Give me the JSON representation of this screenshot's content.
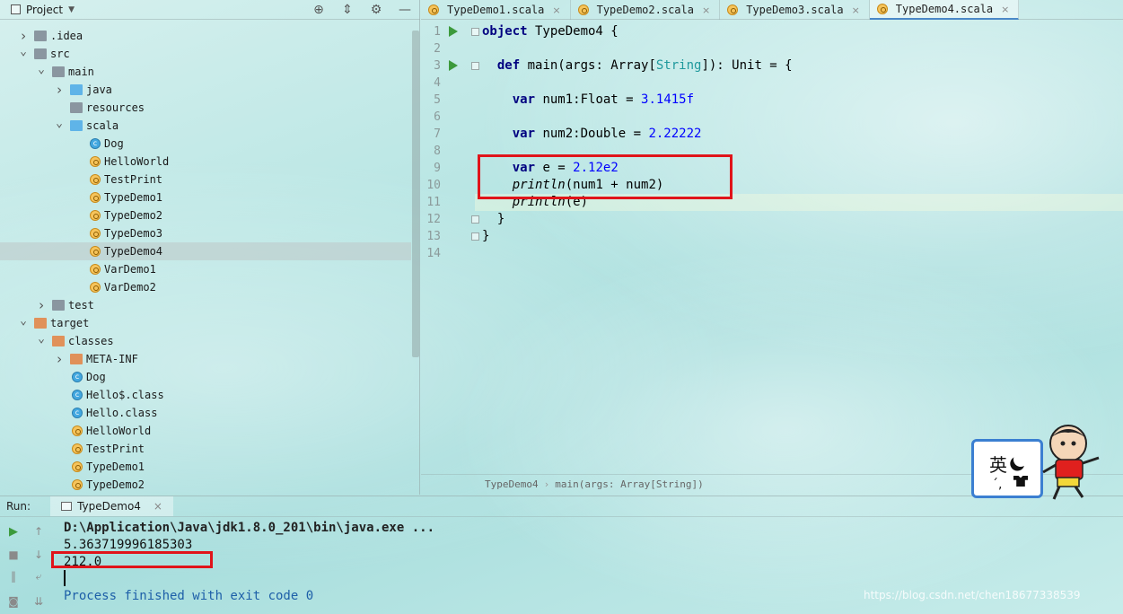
{
  "project_panel": {
    "title": "Project",
    "tree": [
      {
        "label": ".idea",
        "depth": 1,
        "expanded": false,
        "icon": "folder-gray"
      },
      {
        "label": "src",
        "depth": 1,
        "expanded": true,
        "icon": "folder-gray"
      },
      {
        "label": "main",
        "depth": 2,
        "expanded": true,
        "icon": "folder-gray"
      },
      {
        "label": "java",
        "depth": 3,
        "expanded": false,
        "icon": "folder-blue"
      },
      {
        "label": "resources",
        "depth": 3,
        "expanded": null,
        "icon": "folder-res"
      },
      {
        "label": "scala",
        "depth": 3,
        "expanded": true,
        "icon": "folder-blue"
      },
      {
        "label": "Dog",
        "depth": 4,
        "expanded": null,
        "icon": "class"
      },
      {
        "label": "HelloWorld",
        "depth": 4,
        "expanded": null,
        "icon": "object"
      },
      {
        "label": "TestPrint",
        "depth": 4,
        "expanded": null,
        "icon": "object"
      },
      {
        "label": "TypeDemo1",
        "depth": 4,
        "expanded": null,
        "icon": "object"
      },
      {
        "label": "TypeDemo2",
        "depth": 4,
        "expanded": null,
        "icon": "object"
      },
      {
        "label": "TypeDemo3",
        "depth": 4,
        "expanded": null,
        "icon": "object"
      },
      {
        "label": "TypeDemo4",
        "depth": 4,
        "expanded": null,
        "icon": "object",
        "selected": true
      },
      {
        "label": "VarDemo1",
        "depth": 4,
        "expanded": null,
        "icon": "object"
      },
      {
        "label": "VarDemo2",
        "depth": 4,
        "expanded": null,
        "icon": "object"
      },
      {
        "label": "test",
        "depth": 2,
        "expanded": false,
        "icon": "folder-gray"
      },
      {
        "label": "target",
        "depth": 1,
        "expanded": true,
        "icon": "folder-orange"
      },
      {
        "label": "classes",
        "depth": 2,
        "expanded": true,
        "icon": "folder-orange"
      },
      {
        "label": "META-INF",
        "depth": 3,
        "expanded": false,
        "icon": "folder-orange"
      },
      {
        "label": "Dog",
        "depth": 3,
        "expanded": null,
        "icon": "class"
      },
      {
        "label": "Hello$.class",
        "depth": 3,
        "expanded": null,
        "icon": "class"
      },
      {
        "label": "Hello.class",
        "depth": 3,
        "expanded": null,
        "icon": "class"
      },
      {
        "label": "HelloWorld",
        "depth": 3,
        "expanded": null,
        "icon": "object"
      },
      {
        "label": "TestPrint",
        "depth": 3,
        "expanded": null,
        "icon": "object"
      },
      {
        "label": "TypeDemo1",
        "depth": 3,
        "expanded": null,
        "icon": "object"
      },
      {
        "label": "TypeDemo2",
        "depth": 3,
        "expanded": null,
        "icon": "object"
      }
    ]
  },
  "editor": {
    "tabs": [
      {
        "label": "TypeDemo1.scala",
        "active": false
      },
      {
        "label": "TypeDemo2.scala",
        "active": false
      },
      {
        "label": "TypeDemo3.scala",
        "active": false
      },
      {
        "label": "TypeDemo4.scala",
        "active": true
      }
    ],
    "line_numbers": [
      "1",
      "2",
      "3",
      "4",
      "5",
      "6",
      "7",
      "8",
      "9",
      "10",
      "11",
      "12",
      "13",
      "14"
    ],
    "code": [
      {
        "indent": "",
        "tokens": [
          [
            "kw",
            "object"
          ],
          [
            "",
            " TypeDemo4 {"
          ]
        ]
      },
      {
        "indent": "",
        "tokens": []
      },
      {
        "indent": "  ",
        "tokens": [
          [
            "kw",
            "def"
          ],
          [
            "",
            " main(args: Array["
          ],
          [
            "typ",
            "String"
          ],
          [
            "",
            "]): Unit = {"
          ]
        ]
      },
      {
        "indent": "",
        "tokens": []
      },
      {
        "indent": "    ",
        "tokens": [
          [
            "kw",
            "var"
          ],
          [
            "",
            " num1:Float = "
          ],
          [
            "num",
            "3.1415f"
          ]
        ]
      },
      {
        "indent": "",
        "tokens": []
      },
      {
        "indent": "    ",
        "tokens": [
          [
            "kw",
            "var"
          ],
          [
            "",
            " num2:Double = "
          ],
          [
            "num",
            "2.22222"
          ]
        ]
      },
      {
        "indent": "",
        "tokens": []
      },
      {
        "indent": "    ",
        "tokens": [
          [
            "kw",
            "var"
          ],
          [
            "",
            " e = "
          ],
          [
            "num",
            "2.12e2"
          ]
        ]
      },
      {
        "indent": "    ",
        "tokens": [
          [
            "fn",
            "println"
          ],
          [
            "",
            "(num1 + num2)"
          ]
        ]
      },
      {
        "indent": "    ",
        "tokens": [
          [
            "fn",
            "println"
          ],
          [
            "",
            "(e)"
          ]
        ]
      },
      {
        "indent": "  ",
        "tokens": [
          [
            "",
            "}"
          ]
        ]
      },
      {
        "indent": "",
        "tokens": [
          [
            "",
            "}"
          ]
        ]
      },
      {
        "indent": "",
        "tokens": []
      }
    ],
    "breadcrumb": {
      "object": "TypeDemo4",
      "method": "main(args: Array[String])"
    }
  },
  "run_panel": {
    "label": "Run:",
    "tab_label": "TypeDemo4",
    "console": [
      {
        "kind": "cmd",
        "text": "D:\\Application\\Java\\jdk1.8.0_201\\bin\\java.exe ..."
      },
      {
        "kind": "out",
        "text": "5.363719996185303"
      },
      {
        "kind": "out",
        "text": "212.0"
      },
      {
        "kind": "blank",
        "text": ""
      },
      {
        "kind": "exit",
        "text": "Process finished with exit code 0"
      }
    ]
  },
  "ime": {
    "glyph": "英",
    "dots": "´,"
  },
  "watermark": "https://blog.csdn.net/chen18677338539",
  "colors": {
    "highlight_box": "#e0141a",
    "keyword": "#000080",
    "number": "#0000ff",
    "type": "#20999d",
    "exit_text": "#1d5fa8",
    "run_icon": "#3c9a3c"
  }
}
